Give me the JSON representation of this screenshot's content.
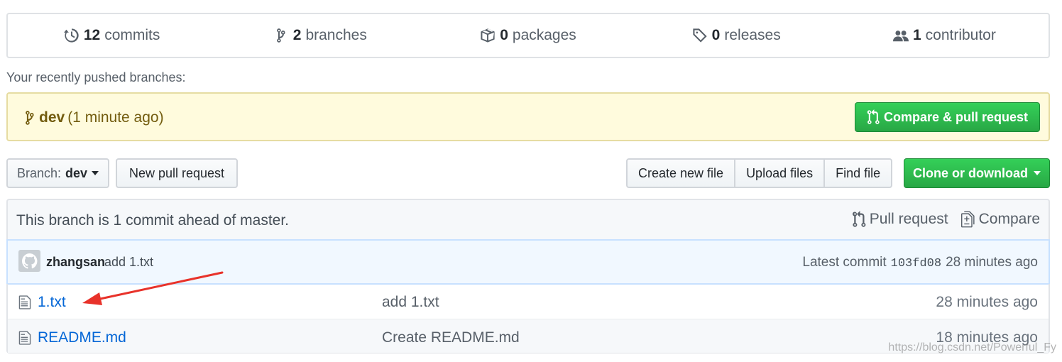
{
  "summary": {
    "commits": {
      "num": "12",
      "label": "commits"
    },
    "branches": {
      "num": "2",
      "label": "branches"
    },
    "packages": {
      "num": "0",
      "label": "packages"
    },
    "releases": {
      "num": "0",
      "label": "releases"
    },
    "contributors": {
      "num": "1",
      "label": "contributor"
    }
  },
  "recent": {
    "label": "Your recently pushed branches:",
    "branch": "dev",
    "time": "(1 minute ago)",
    "compare_button": "Compare & pull request"
  },
  "nav": {
    "branch_label": "Branch:",
    "branch_value": "dev",
    "new_pr": "New pull request",
    "create_file": "Create new file",
    "upload_files": "Upload files",
    "find_file": "Find file",
    "clone": "Clone or download"
  },
  "infobar": {
    "text": "This branch is 1 commit ahead of master.",
    "pull_request": "Pull request",
    "compare": "Compare"
  },
  "commit": {
    "author": "zhangsan",
    "message": "add 1.txt",
    "latest_label": "Latest commit",
    "sha": "103fd08",
    "age": "28 minutes ago"
  },
  "files": [
    {
      "name": "1.txt",
      "commit": "add 1.txt",
      "age": "28 minutes ago"
    },
    {
      "name": "README.md",
      "commit": "Create README.md",
      "age": "18 minutes ago"
    }
  ],
  "annotation": {
    "arrow_color": "#e8322a"
  },
  "watermark": "https://blog.csdn.net/Powerful_Fy",
  "colors": {
    "green": "#28a745",
    "link": "#0366d6",
    "banner": "#fffbdd"
  }
}
